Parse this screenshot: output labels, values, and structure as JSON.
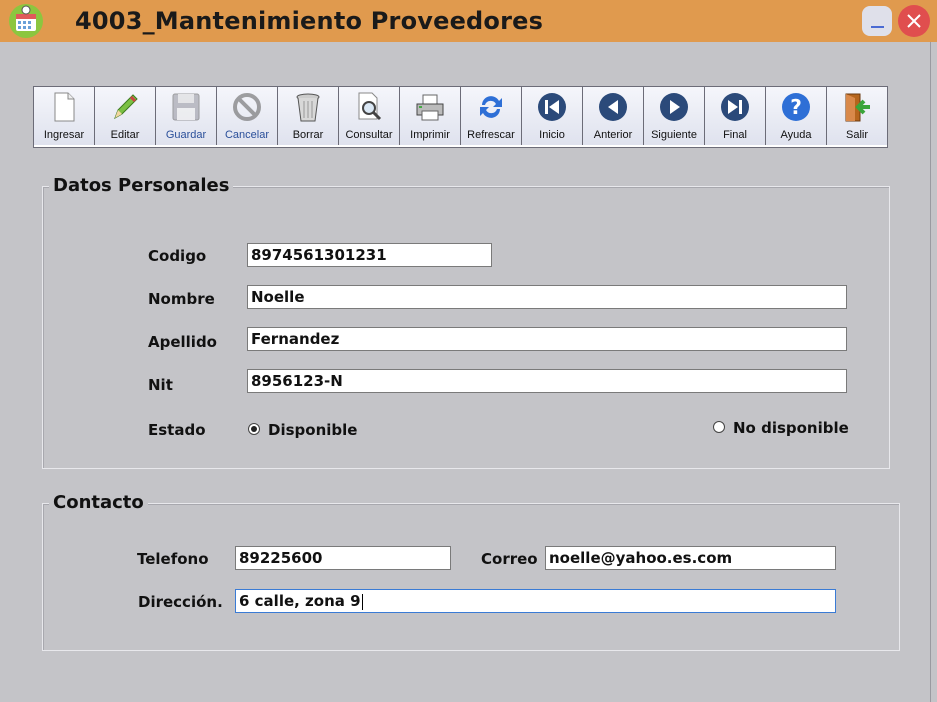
{
  "window": {
    "title": "4003_Mantenimiento Proveedores",
    "minimize_icon": "minimize-icon",
    "close_icon": "close-icon",
    "app_icon": "calendar-app-icon"
  },
  "toolbar": {
    "buttons": [
      {
        "label": "Ingresar",
        "icon": "new-document-icon"
      },
      {
        "label": "Editar",
        "icon": "pencil-icon"
      },
      {
        "label": "Guardar",
        "icon": "floppy-disk-icon"
      },
      {
        "label": "Cancelar",
        "icon": "cancel-icon"
      },
      {
        "label": "Borrar",
        "icon": "trash-icon"
      },
      {
        "label": "Consultar",
        "icon": "search-document-icon"
      },
      {
        "label": "Imprimir",
        "icon": "printer-icon"
      },
      {
        "label": "Refrescar",
        "icon": "refresh-icon"
      },
      {
        "label": "Inicio",
        "icon": "first-record-icon"
      },
      {
        "label": "Anterior",
        "icon": "previous-record-icon"
      },
      {
        "label": "Siguiente",
        "icon": "next-record-icon"
      },
      {
        "label": "Final",
        "icon": "last-record-icon"
      },
      {
        "label": "Ayuda",
        "icon": "help-icon"
      },
      {
        "label": "Salir",
        "icon": "exit-door-icon"
      }
    ]
  },
  "datos": {
    "title": "Datos Personales",
    "codigo_label": "Codigo",
    "codigo_value": "8974561301231",
    "nombre_label": "Nombre",
    "nombre_value": "Noelle",
    "apellido_label": "Apellido",
    "apellido_value": "Fernandez",
    "nit_label": "Nit",
    "nit_value": "8956123-N",
    "estado_label": "Estado",
    "estado_options": [
      {
        "label": "Disponible",
        "checked": true
      },
      {
        "label": "No disponible",
        "checked": false
      }
    ]
  },
  "contacto": {
    "title": "Contacto",
    "telefono_label": "Telefono",
    "telefono_value": "89225600",
    "correo_label": "Correo",
    "correo_value": "noelle@yahoo.es.com",
    "direccion_label": "Dirección.",
    "direccion_value": "6 calle, zona 9"
  },
  "colors": {
    "titlebar": "#e09a4e",
    "window_bg": "#c4c4c8",
    "close": "#e04e4e",
    "accent_blue": "#3a6fd8"
  }
}
